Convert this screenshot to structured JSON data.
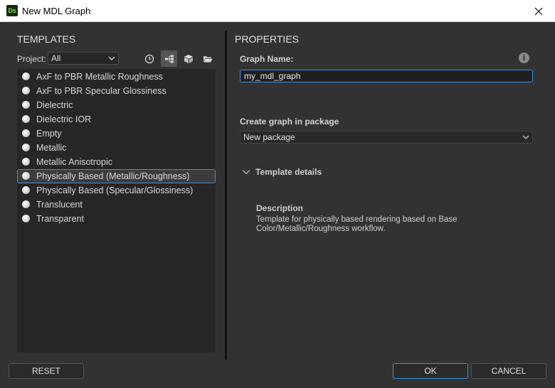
{
  "window": {
    "title": "New MDL Graph",
    "logo_text": "Ds"
  },
  "templates": {
    "title": "TEMPLATES",
    "project_label": "Project:",
    "project_value": "All",
    "toolbar": [
      {
        "name": "recent-icon",
        "active": false
      },
      {
        "name": "graph-templates-icon",
        "active": true
      },
      {
        "name": "package-icon",
        "active": false
      },
      {
        "name": "folder-icon",
        "active": false
      }
    ],
    "items": [
      {
        "label": "AxF to PBR Metallic Roughness",
        "selected": false
      },
      {
        "label": "AxF to PBR Specular Glossiness",
        "selected": false
      },
      {
        "label": "Dielectric",
        "selected": false
      },
      {
        "label": "Dielectric IOR",
        "selected": false
      },
      {
        "label": "Empty",
        "selected": false
      },
      {
        "label": "Metallic",
        "selected": false
      },
      {
        "label": "Metallic Anisotropic",
        "selected": false
      },
      {
        "label": "Physically Based (Metallic/Roughness)",
        "selected": true
      },
      {
        "label": "Physically Based (Specular/Glossiness)",
        "selected": false
      },
      {
        "label": "Translucent",
        "selected": false
      },
      {
        "label": "Transparent",
        "selected": false
      }
    ]
  },
  "properties": {
    "title": "PROPERTIES",
    "graph_name_label": "Graph Name:",
    "graph_name_value": "my_mdl_graph",
    "package_label": "Create graph in package",
    "package_value": "New package",
    "details_label": "Template details",
    "description_heading": "Description",
    "description_text": "Template for physically based rendering based on Base Color/Metallic/Roughness workflow."
  },
  "buttons": {
    "reset": "RESET",
    "ok": "OK",
    "cancel": "CANCEL"
  },
  "colors": {
    "accent": "#3b8fe0",
    "background": "#323232",
    "list_background": "#262626"
  }
}
